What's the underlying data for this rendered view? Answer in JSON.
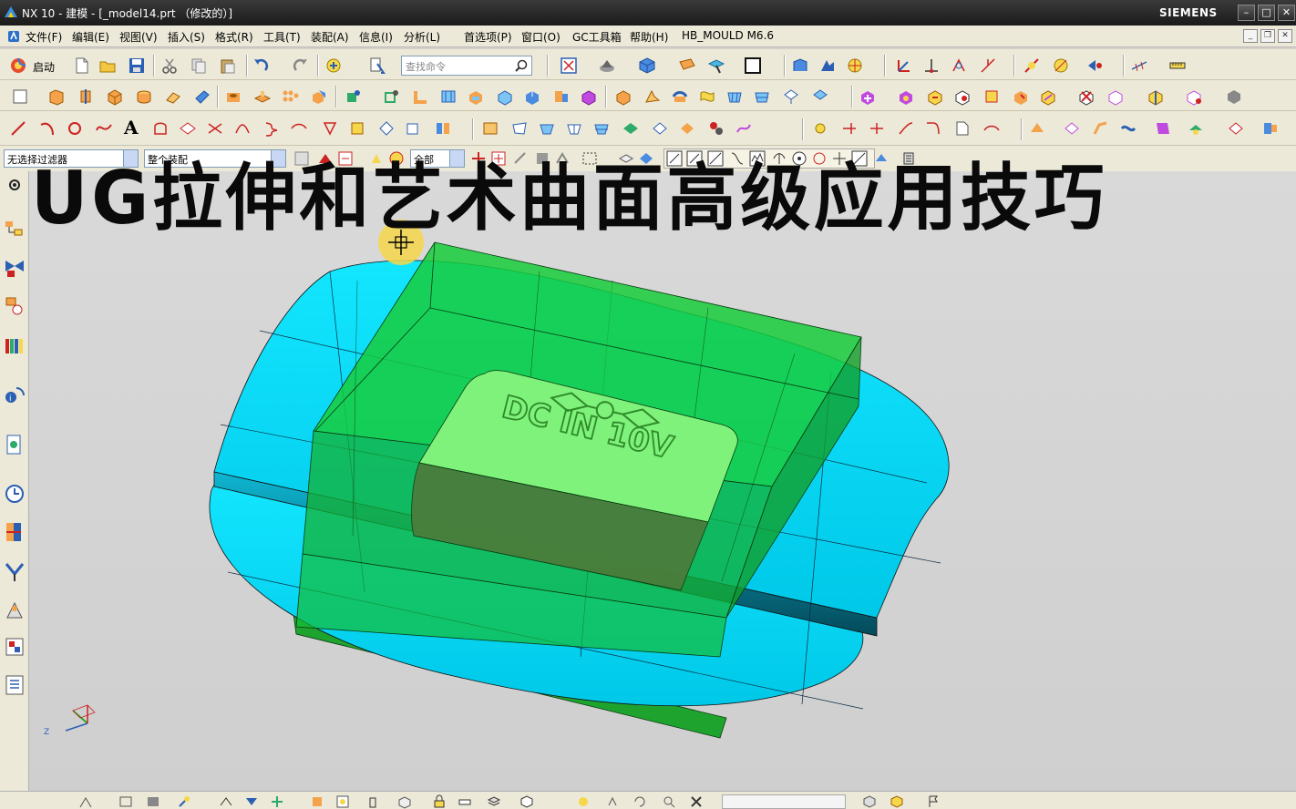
{
  "window": {
    "title": "NX 10 - 建模 - [_model14.prt （修改的）]",
    "brand": "SIEMENS",
    "controls": [
      "minimize",
      "maximize",
      "close"
    ]
  },
  "menubar": {
    "items": [
      "文件(F)",
      "编辑(E)",
      "视图(V)",
      "插入(S)",
      "格式(R)",
      "工具(T)",
      "装配(A)",
      "信息(I)",
      "分析(L)",
      "首选项(P)",
      "窗口(O)",
      "GC工具箱",
      "帮助(H)",
      "HB_MOULD M6.6"
    ]
  },
  "toolbar": {
    "start_label": "启动",
    "command_search_placeholder": "查找命令"
  },
  "selection_bar": {
    "filter_value": "无选择过滤器",
    "scope_value": "整个装配",
    "type_value": "全部"
  },
  "overlay": {
    "title": "UG拉伸和艺术曲面高级应用技巧"
  },
  "model": {
    "embossed_text": "DC IN 10V",
    "colors": {
      "surface": "#00e5ff",
      "solid": "#1fc43a",
      "solid_dark": "#129d25",
      "label_pad": "#7ef27a",
      "viewport_bg": "#d6d6d6"
    }
  },
  "triad": {
    "axis_z": "Z"
  },
  "icons": {
    "left_toolbar": [
      "settings-icon",
      "assembly-navigator-icon",
      "constraint-navigator-icon",
      "part-navigator-icon",
      "reuse-library-icon",
      "hd3d-tools-icon",
      "web-browser-icon",
      "history-icon",
      "system-materials-icon",
      "process-studio-icon",
      "manufacturing-wizard-icon",
      "roles-icon",
      "system-scene-icon"
    ]
  }
}
